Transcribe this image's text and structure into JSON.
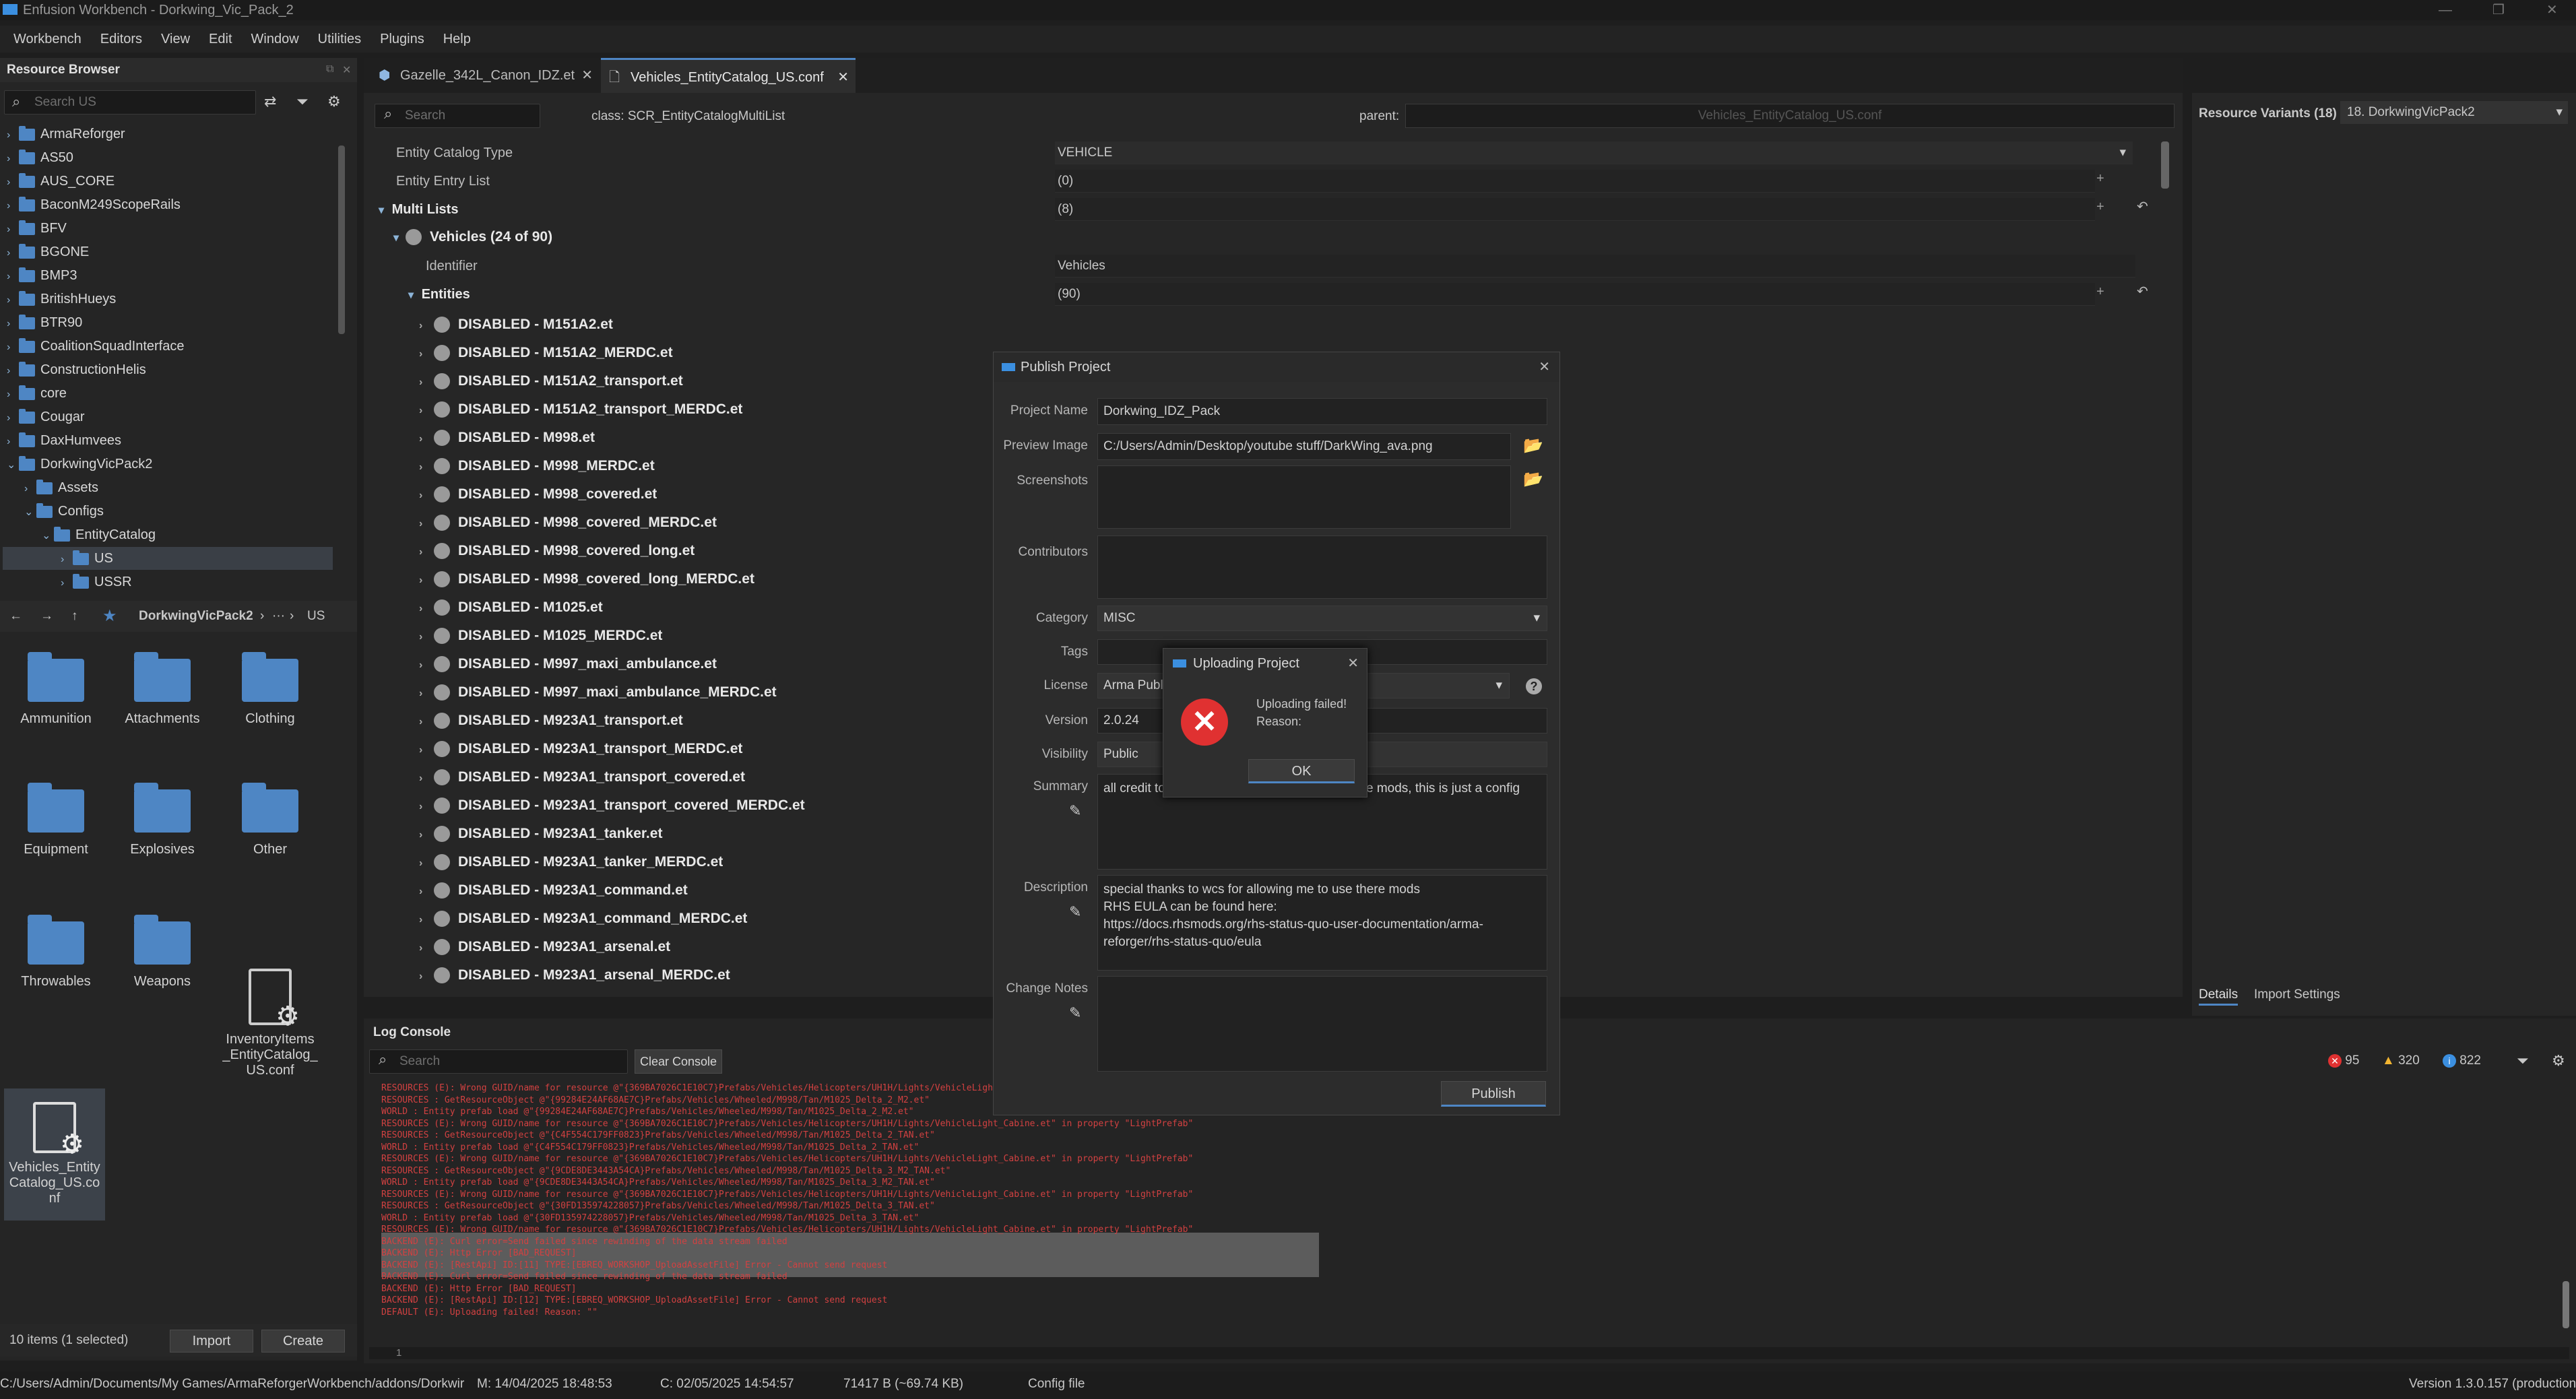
{
  "window": {
    "title": "Enfusion Workbench - Dorkwing_Vic_Pack_2"
  },
  "menu": [
    "Workbench",
    "Editors",
    "View",
    "Edit",
    "Window",
    "Utilities",
    "Plugins",
    "Help"
  ],
  "resource_browser": {
    "title": "Resource Browser",
    "search_placeholder": "Search US",
    "tree": [
      "ArmaReforger",
      "AS50",
      "AUS_CORE",
      "BaconM249ScopeRails",
      "BFV",
      "BGONE",
      "BMP3",
      "BritishHueys",
      "BTR90",
      "CoalitionSquadInterface",
      "ConstructionHelis",
      "core",
      "Cougar",
      "DaxHumvees"
    ],
    "tree_expanded": {
      "root": "DorkwingVicPack2",
      "assets": "Assets",
      "configs": "Configs",
      "entity_catalog": "EntityCatalog",
      "us": "US",
      "ussr": "USSR"
    },
    "breadcrumb": {
      "root": "DorkwingVicPack2",
      "sep": "›",
      "ellipsis": "···",
      "current": "US"
    },
    "tiles": [
      {
        "label": "Ammunition"
      },
      {
        "label": "Attachments"
      },
      {
        "label": "Clothing"
      },
      {
        "label": "Equipment"
      },
      {
        "label": "Explosives"
      },
      {
        "label": "Other"
      },
      {
        "label": "Throwables"
      },
      {
        "label": "Weapons"
      },
      {
        "label": "InventoryItems _EntityCatalog_ US.conf"
      },
      {
        "label": "Vehicles_Entity Catalog_US.co nf"
      }
    ],
    "footer": {
      "count": "10 items (1 selected)",
      "import": "Import",
      "create": "Create"
    }
  },
  "tabs": [
    {
      "label": "Gazelle_342L_Canon_IDZ.et"
    },
    {
      "label": "Vehicles_EntityCatalog_US.conf"
    }
  ],
  "editor": {
    "search_placeholder": "Search",
    "class_label": "class: SCR_EntityCatalogMultiList",
    "parent_label": "parent:",
    "parent_value": "Vehicles_EntityCatalog_US.conf",
    "props": {
      "catalog_type_label": "Entity Catalog Type",
      "catalog_type_value": "VEHICLE",
      "entry_list_label": "Entity Entry List",
      "entry_list_value": "(0)",
      "multi_lists_label": "Multi Lists",
      "multi_lists_value": "(8)",
      "vehicles_label": "Vehicles (24 of 90)",
      "identifier_label": "Identifier",
      "identifier_value": "Vehicles",
      "entities_label": "Entities",
      "entities_value": "(90)"
    },
    "entities": [
      "DISABLED - M151A2.et",
      "DISABLED - M151A2_MERDC.et",
      "DISABLED - M151A2_transport.et",
      "DISABLED - M151A2_transport_MERDC.et",
      "DISABLED - M998.et",
      "DISABLED - M998_MERDC.et",
      "DISABLED - M998_covered.et",
      "DISABLED - M998_covered_MERDC.et",
      "DISABLED - M998_covered_long.et",
      "DISABLED - M998_covered_long_MERDC.et",
      "DISABLED - M1025.et",
      "DISABLED - M1025_MERDC.et",
      "DISABLED - M997_maxi_ambulance.et",
      "DISABLED - M997_maxi_ambulance_MERDC.et",
      "DISABLED - M923A1_transport.et",
      "DISABLED - M923A1_transport_MERDC.et",
      "DISABLED - M923A1_transport_covered.et",
      "DISABLED - M923A1_transport_covered_MERDC.et",
      "DISABLED - M923A1_tanker.et",
      "DISABLED - M923A1_tanker_MERDC.et",
      "DISABLED - M923A1_command.et",
      "DISABLED - M923A1_command_MERDC.et",
      "DISABLED - M923A1_arsenal.et",
      "DISABLED - M923A1_arsenal_MERDC.et"
    ]
  },
  "right_panel": {
    "title": "Resource Variants (18)",
    "selected": "18. DorkwingVicPack2",
    "tab_details": "Details",
    "tab_import": "Import Settings"
  },
  "publish": {
    "title": "Publish Project",
    "project_name_label": "Project Name",
    "project_name": "Dorkwing_IDZ_Pack",
    "preview_label": "Preview Image",
    "preview_path": "C:/Users/Admin/Desktop/youtube stuff/DarkWing_ava.png",
    "screenshots_label": "Screenshots",
    "contributors_label": "Contributors",
    "category_label": "Category",
    "category": "MISC",
    "tags_label": "Tags",
    "license_label": "License",
    "license": "Arma Publ",
    "version_label": "Version",
    "version": "2.0.24",
    "visibility_label": "Visibility",
    "visibility": "Public",
    "summary_label": "Summary",
    "summary_a": "all credit to",
    "summary_b": "e mods, this is just a config",
    "description_label": "Description",
    "description": [
      "special thanks to wcs for allowing me to use there mods",
      "RHS EULA can be found here:",
      "https://docs.rhsmods.org/rhs-status-quo-user-documentation/arma-",
      "reforger/rhs-status-quo/eula"
    ],
    "change_notes_label": "Change Notes",
    "publish_button": "Publish"
  },
  "uploading": {
    "title": "Uploading Project",
    "message": "Uploading failed!",
    "reason": "Reason:",
    "ok": "OK"
  },
  "log": {
    "title": "Log Console",
    "search_placeholder": "Search",
    "clear": "Clear Console",
    "errors": "95",
    "warnings": "320",
    "infos": "822",
    "lines": [
      "RESOURCES (E): Wrong GUID/name for resource @\"{369BA7026C1E10C7}Prefabs/Vehicles/Helicopters/UH1H/Lights/VehicleLight_Cabine.et\" in property \"LightPrefab\"",
      "RESOURCES   : GetResourceObject @\"{99284E24AF68AE7C}Prefabs/Vehicles/Wheeled/M998/Tan/M1025_Delta_2_M2.et\"",
      " WORLD       : Entity prefab load @\"{99284E24AF68AE7C}Prefabs/Vehicles/Wheeled/M998/Tan/M1025_Delta_2_M2.et\"",
      "  RESOURCES (E): Wrong GUID/name for resource @\"{369BA7026C1E10C7}Prefabs/Vehicles/Helicopters/UH1H/Lights/VehicleLight_Cabine.et\" in property \"LightPrefab\"",
      "RESOURCES   : GetResourceObject @\"{C4F554C179FF0823}Prefabs/Vehicles/Wheeled/M998/Tan/M1025_Delta_2_TAN.et\"",
      " WORLD       : Entity prefab load @\"{C4F554C179FF0823}Prefabs/Vehicles/Wheeled/M998/Tan/M1025_Delta_2_TAN.et\"",
      "  RESOURCES (E): Wrong GUID/name for resource @\"{369BA7026C1E10C7}Prefabs/Vehicles/Helicopters/UH1H/Lights/VehicleLight_Cabine.et\" in property \"LightPrefab\"",
      "RESOURCES   : GetResourceObject @\"{9CDE8DE3443A54CA}Prefabs/Vehicles/Wheeled/M998/Tan/M1025_Delta_3_M2_TAN.et\"",
      " WORLD       : Entity prefab load @\"{9CDE8DE3443A54CA}Prefabs/Vehicles/Wheeled/M998/Tan/M1025_Delta_3_M2_TAN.et\"",
      "  RESOURCES (E): Wrong GUID/name for resource @\"{369BA7026C1E10C7}Prefabs/Vehicles/Helicopters/UH1H/Lights/VehicleLight_Cabine.et\" in property \"LightPrefab\"",
      "RESOURCES   : GetResourceObject @\"{30FD135974228057}Prefabs/Vehicles/Wheeled/M998/Tan/M1025_Delta_3_TAN.et\"",
      " WORLD       : Entity prefab load @\"{30FD135974228057}Prefabs/Vehicles/Wheeled/M998/Tan/M1025_Delta_3_TAN.et\"",
      "  RESOURCES (E): Wrong GUID/name for resource @\"{369BA7026C1E10C7}Prefabs/Vehicles/Helicopters/UH1H/Lights/VehicleLight_Cabine.et\" in property \"LightPrefab\"",
      "BACKEND   (E): Curl error=Send failed since rewinding of the data stream failed",
      "BACKEND   (E): Http Error [BAD_REQUEST]",
      "BACKEND   (E): [RestApi] ID:[11] TYPE:[EBREQ_WORKSHOP_UploadAssetFile] Error - Cannot send request",
      "BACKEND   (E): Curl error=Send failed since rewinding of the data stream failed",
      "BACKEND   (E): Http Error [BAD_REQUEST]",
      "BACKEND   (E): [RestApi] ID:[12] TYPE:[EBREQ_WORKSHOP_UploadAssetFile] Error - Cannot send request",
      "DEFAULT   (E): Uploading failed! Reason: \"\""
    ],
    "page": "1"
  },
  "statusbar": {
    "path": "C:/Users/Admin/Documents/My Games/ArmaReforgerWorkbench/addons/Dorkwir",
    "modified": "M: 14/04/2025 18:48:53",
    "created": "C: 02/05/2025 14:54:57",
    "size": "71417 B (~69.74 KB)",
    "type": "Config file",
    "version": "Version 1.3.0.157 (production"
  },
  "colors": {
    "accent": "#4e86c4",
    "error": "#e03131",
    "warning": "#f2b531",
    "info": "#3b8fe0"
  }
}
